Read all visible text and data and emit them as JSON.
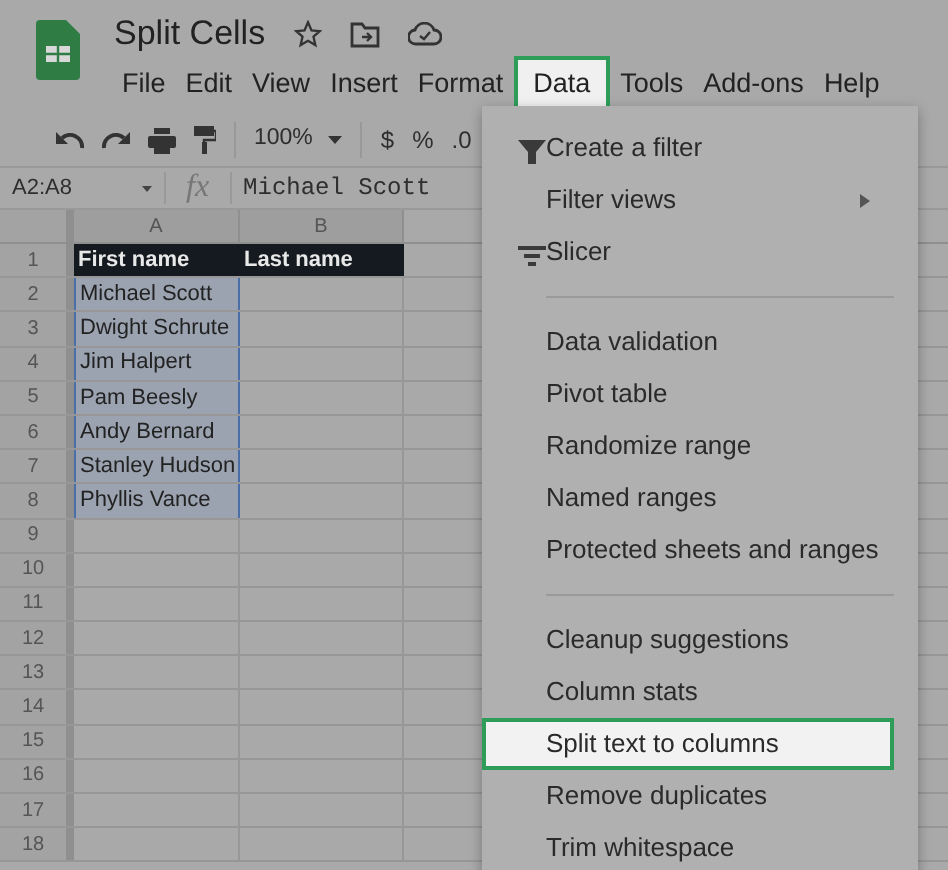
{
  "document": {
    "title": "Split Cells"
  },
  "menu_bar": [
    {
      "label": "File",
      "selected": false
    },
    {
      "label": "Edit",
      "selected": false
    },
    {
      "label": "View",
      "selected": false
    },
    {
      "label": "Insert",
      "selected": false
    },
    {
      "label": "Format",
      "selected": false
    },
    {
      "label": "Data",
      "selected": true
    },
    {
      "label": "Tools",
      "selected": false
    },
    {
      "label": "Add-ons",
      "selected": false
    },
    {
      "label": "Help",
      "selected": false
    }
  ],
  "toolbar": {
    "zoom": "100%",
    "currency": "$",
    "percent": "%",
    "decimal": ".0"
  },
  "formula_bar": {
    "name_box": "A2:A8",
    "fx": "fx",
    "value": "Michael Scott"
  },
  "sheet": {
    "columns": [
      "A",
      "B"
    ],
    "rows": [
      {
        "number": "1",
        "header": true,
        "cells": [
          {
            "text": "First name",
            "selected": false
          },
          {
            "text": "Last name",
            "selected": false
          }
        ]
      },
      {
        "number": "2",
        "header": false,
        "cells": [
          {
            "text": "Michael Scott",
            "selected": true
          },
          {
            "selected": false
          }
        ]
      },
      {
        "number": "3",
        "header": false,
        "cells": [
          {
            "text": "Dwight Schrute",
            "selected": true
          },
          {
            "selected": false
          }
        ]
      },
      {
        "number": "4",
        "header": false,
        "cells": [
          {
            "text": "Jim Halpert",
            "selected": true
          },
          {
            "selected": false
          }
        ]
      },
      {
        "number": "5",
        "header": false,
        "cells": [
          {
            "text": "Pam Beesly",
            "selected": true
          },
          {
            "selected": false
          }
        ]
      },
      {
        "number": "6",
        "header": false,
        "cells": [
          {
            "text": "Andy Bernard",
            "selected": true
          },
          {
            "selected": false
          }
        ]
      },
      {
        "number": "7",
        "header": false,
        "cells": [
          {
            "text": "Stanley Hudson",
            "selected": true
          },
          {
            "selected": false
          }
        ]
      },
      {
        "number": "8",
        "header": false,
        "cells": [
          {
            "text": "Phyllis Vance",
            "selected": true
          },
          {
            "selected": false
          }
        ]
      },
      {
        "number": "9",
        "header": false,
        "cells": [
          {
            "selected": false
          },
          {
            "selected": false
          }
        ]
      },
      {
        "number": "10",
        "header": false,
        "cells": [
          {
            "selected": false
          },
          {
            "selected": false
          }
        ]
      },
      {
        "number": "11",
        "header": false,
        "cells": [
          {
            "selected": false
          },
          {
            "selected": false
          }
        ]
      },
      {
        "number": "12",
        "header": false,
        "cells": [
          {
            "selected": false
          },
          {
            "selected": false
          }
        ]
      },
      {
        "number": "13",
        "header": false,
        "cells": [
          {
            "selected": false
          },
          {
            "selected": false
          }
        ]
      },
      {
        "number": "14",
        "header": false,
        "cells": [
          {
            "selected": false
          },
          {
            "selected": false
          }
        ]
      },
      {
        "number": "15",
        "header": false,
        "cells": [
          {
            "selected": false
          },
          {
            "selected": false
          }
        ]
      },
      {
        "number": "16",
        "header": false,
        "cells": [
          {
            "selected": false
          },
          {
            "selected": false
          }
        ]
      },
      {
        "number": "17",
        "header": false,
        "cells": [
          {
            "selected": false
          },
          {
            "selected": false
          }
        ]
      },
      {
        "number": "18",
        "header": false,
        "cells": [
          {
            "selected": false
          },
          {
            "selected": false
          }
        ]
      }
    ]
  },
  "data_menu": [
    {
      "kind": "filter",
      "label": "Create a filter",
      "submenu": false,
      "selected": false
    },
    {
      "kind": "item",
      "label": "Filter views",
      "submenu": true,
      "selected": false
    },
    {
      "kind": "slicer",
      "label": "Slicer",
      "submenu": false,
      "selected": false
    },
    {
      "kind": "divider"
    },
    {
      "kind": "item",
      "label": "Data validation",
      "submenu": false,
      "selected": false
    },
    {
      "kind": "item",
      "label": "Pivot table",
      "submenu": false,
      "selected": false
    },
    {
      "kind": "item",
      "label": "Randomize range",
      "submenu": false,
      "selected": false
    },
    {
      "kind": "item",
      "label": "Named ranges",
      "submenu": false,
      "selected": false
    },
    {
      "kind": "item",
      "label": "Protected sheets and ranges",
      "submenu": false,
      "selected": false
    },
    {
      "kind": "divider"
    },
    {
      "kind": "item",
      "label": "Cleanup suggestions",
      "submenu": false,
      "selected": false
    },
    {
      "kind": "item",
      "label": "Column stats",
      "submenu": false,
      "selected": false
    },
    {
      "kind": "item",
      "label": "Split text to columns",
      "submenu": false,
      "selected": true
    },
    {
      "kind": "item",
      "label": "Remove duplicates",
      "submenu": false,
      "selected": false
    },
    {
      "kind": "item",
      "label": "Trim whitespace",
      "submenu": false,
      "selected": false
    }
  ]
}
